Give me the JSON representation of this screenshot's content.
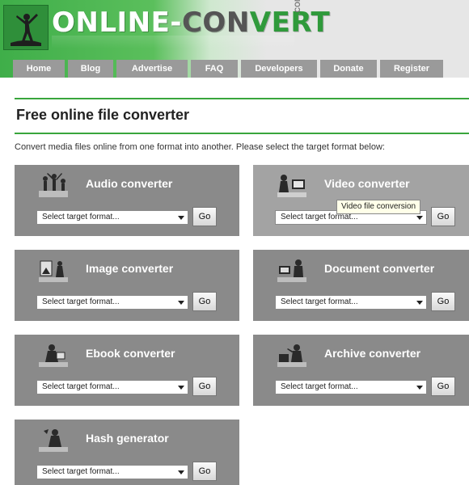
{
  "site": {
    "logo_part1": "ONLINE",
    "logo_dash": "-",
    "logo_part2": "CON",
    "logo_part3": "VERT",
    "logo_com": ".COM"
  },
  "nav": [
    "Home",
    "Blog",
    "Advertise",
    "FAQ",
    "Developers",
    "Donate",
    "Register"
  ],
  "page": {
    "title": "Free online file converter",
    "description": "Convert media files online from one format into another. Please select the target format below:"
  },
  "converters": [
    {
      "label": "Audio converter",
      "icon": "audio-people-icon",
      "select": "Select target format...",
      "go": "Go"
    },
    {
      "label": "Video converter",
      "icon": "video-person-icon",
      "select": "Select target format...",
      "go": "Go"
    },
    {
      "label": "Image converter",
      "icon": "image-person-icon",
      "select": "Select target format...",
      "go": "Go"
    },
    {
      "label": "Document converter",
      "icon": "document-person-icon",
      "select": "Select target format...",
      "go": "Go"
    },
    {
      "label": "Ebook converter",
      "icon": "ebook-reader-icon",
      "select": "Select target format...",
      "go": "Go"
    },
    {
      "label": "Archive converter",
      "icon": "archive-person-icon",
      "select": "Select target format...",
      "go": "Go"
    },
    {
      "label": "Hash generator",
      "icon": "hash-person-icon",
      "select": "Select target format...",
      "go": "Go"
    }
  ],
  "tooltip": "Video file conversion",
  "colors": {
    "accent_green": "#39a53c",
    "card_gray": "#8a8a8a",
    "card_highlight": "#a3a3a3"
  }
}
